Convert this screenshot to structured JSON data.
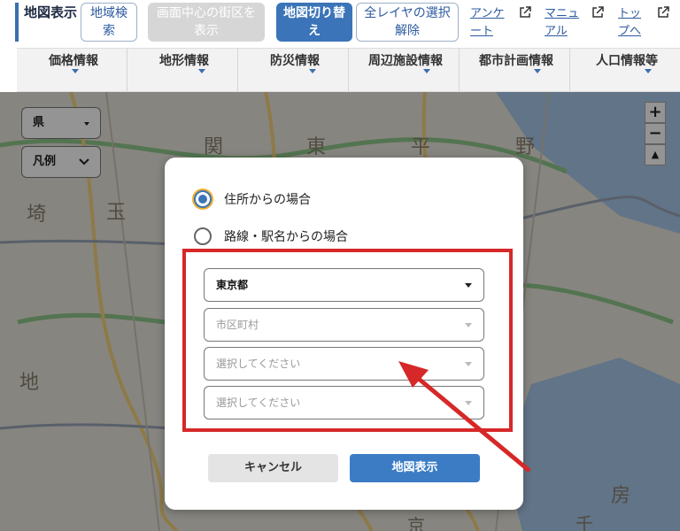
{
  "toolbar": {
    "title": "地図表示",
    "buttons": [
      {
        "label": "地域検索"
      },
      {
        "label": "画面中心の街区を表示"
      },
      {
        "label": "地図切り替え"
      },
      {
        "label": "全レイヤの選択解除"
      }
    ],
    "links": [
      {
        "label": "アンケート"
      },
      {
        "label": "マニュアル"
      },
      {
        "label": "トップへ"
      }
    ]
  },
  "menu": [
    {
      "label": "価格情報"
    },
    {
      "label": "地形情報"
    },
    {
      "label": "防災情報"
    },
    {
      "label": "周辺施設情報"
    },
    {
      "label": "都市計画情報"
    },
    {
      "label": "人口情報等"
    }
  ],
  "map": {
    "prefecture_select": "県",
    "legend_select": "凡例",
    "zoom_in": "+",
    "zoom_out": "−",
    "compass": "▲",
    "place_labels": [
      "関",
      "東",
      "平",
      "野",
      "玉",
      "埼",
      "地",
      "房",
      "千",
      "京"
    ]
  },
  "dialog": {
    "options": [
      {
        "label": "住所からの場合",
        "checked": true
      },
      {
        "label": "路線・駅名からの場合",
        "checked": false
      }
    ],
    "selects": [
      {
        "value": "東京都",
        "filled": true
      },
      {
        "value": "市区町村",
        "filled": false
      },
      {
        "value": "選択してください",
        "filled": false
      },
      {
        "value": "選択してください",
        "filled": false
      }
    ],
    "cancel_label": "キャンセル",
    "show_label": "地図表示"
  },
  "colors": {
    "accent": "#3b74b8",
    "highlight": "#d62828"
  }
}
